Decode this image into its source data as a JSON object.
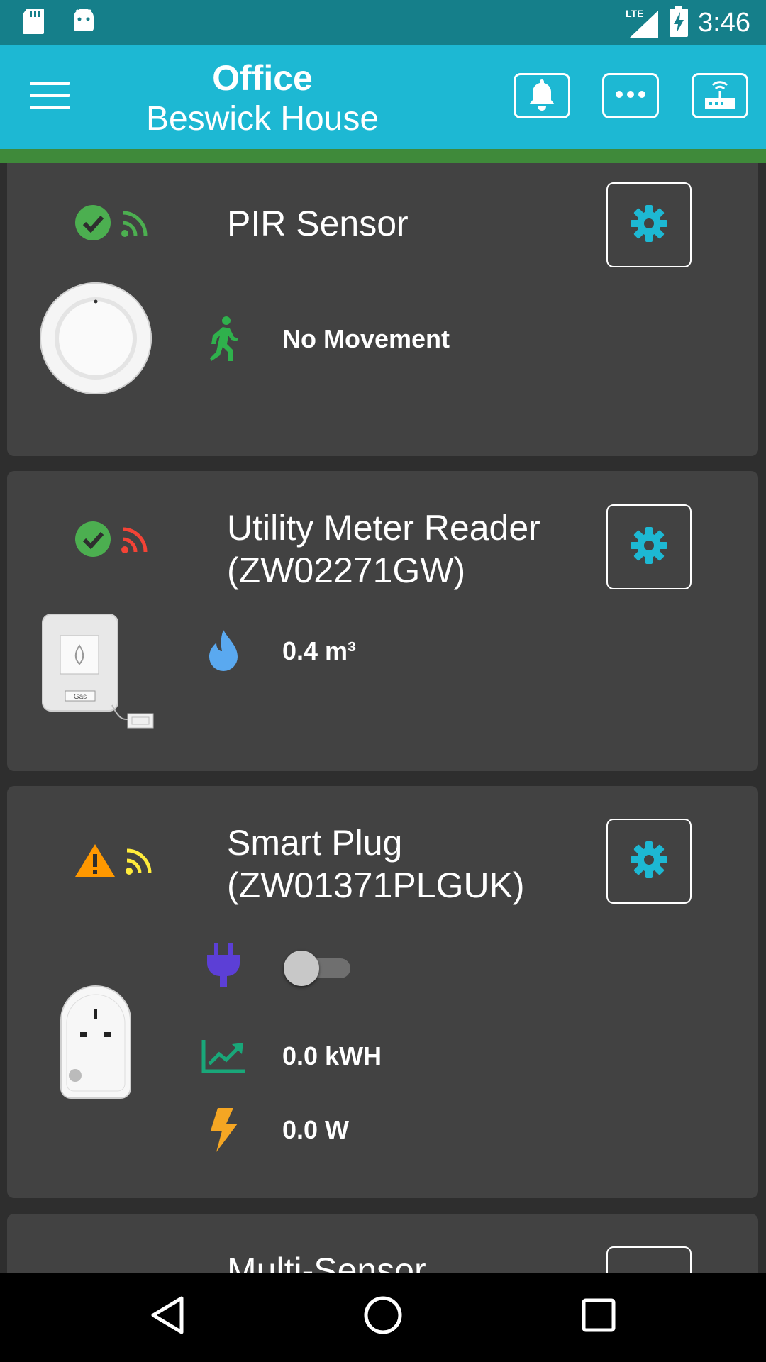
{
  "status_bar": {
    "network": "LTE",
    "time": "3:46"
  },
  "header": {
    "title": "Office",
    "subtitle": "Beswick House",
    "buttons": [
      "bell-icon",
      "more-icon",
      "router-icon"
    ]
  },
  "devices": [
    {
      "name": "PIR Sensor",
      "status_icon": "check-circle-icon",
      "signal_color": "#4caf50",
      "readings": [
        {
          "icon": "walking-person-icon",
          "value": "No Movement"
        }
      ]
    },
    {
      "name_line1": "Utility Meter Reader",
      "name_line2": "(ZW02271GW)",
      "status_icon": "check-circle-icon",
      "signal_color": "#f44336",
      "image_label": "Gas",
      "readings": [
        {
          "icon": "flame-icon",
          "value": "0.4 m³"
        }
      ]
    },
    {
      "name_line1": "Smart Plug",
      "name_line2": "(ZW01371PLGUK)",
      "status_icon": "warning-icon",
      "signal_color": "#ffeb3b",
      "readings": [
        {
          "icon": "plug-icon",
          "value": "off"
        },
        {
          "icon": "trending-up-icon",
          "value": "0.0 kWH"
        },
        {
          "icon": "lightning-icon",
          "value": "0.0 W"
        }
      ]
    },
    {
      "name": "Multi-Sensor"
    }
  ],
  "colors": {
    "app_bar": "#1db8d3",
    "status_bar": "#157f8a",
    "accent": "#3f8a3a",
    "card": "#424242"
  }
}
